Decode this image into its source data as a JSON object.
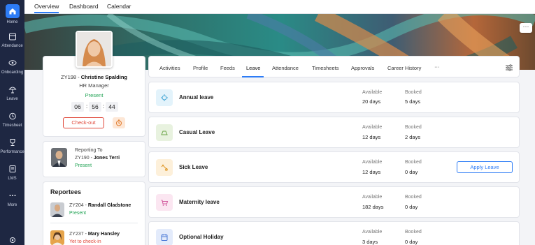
{
  "sidebar": {
    "items": [
      {
        "label": "Home",
        "icon": "home-icon"
      },
      {
        "label": "Attendance",
        "icon": "attendance-icon"
      },
      {
        "label": "Onboarding",
        "icon": "onboarding-icon"
      },
      {
        "label": "Leave",
        "icon": "leave-icon"
      },
      {
        "label": "Timesheet",
        "icon": "timesheet-icon"
      },
      {
        "label": "Performance",
        "icon": "performance-icon"
      },
      {
        "label": "LMS",
        "icon": "lms-icon"
      },
      {
        "label": "More",
        "icon": "more-icon"
      }
    ]
  },
  "topnav": {
    "tabs": [
      {
        "label": "Overview"
      },
      {
        "label": "Dashboard"
      },
      {
        "label": "Calendar"
      }
    ],
    "active": "Overview"
  },
  "banner": {
    "more_label": "···"
  },
  "profile": {
    "id": "ZY198 - ",
    "name": "Christine Spalding",
    "role": "HR Manager",
    "status": "Present",
    "time": {
      "h": "06",
      "m": "56",
      "s": "44"
    },
    "checkout_label": "Check-out"
  },
  "reporting": {
    "label": "Reporting To",
    "id": "ZY190 - ",
    "name": "Jones Terri",
    "status": "Present"
  },
  "reportees": {
    "title": "Reportees",
    "people": [
      {
        "id": "ZY204 - ",
        "name": "Randall Gladstone",
        "status": "Present",
        "status_color": "#22a355"
      },
      {
        "id": "ZY237 - ",
        "name": "Mary Hansley",
        "status": "Yet to check-in",
        "status_color": "#e0483a"
      }
    ]
  },
  "tabs": {
    "items": [
      {
        "label": "Activities"
      },
      {
        "label": "Profile"
      },
      {
        "label": "Feeds"
      },
      {
        "label": "Leave"
      },
      {
        "label": "Attendance"
      },
      {
        "label": "Timesheets"
      },
      {
        "label": "Approvals"
      },
      {
        "label": "Career History"
      },
      {
        "label": "···"
      }
    ],
    "active": "Leave"
  },
  "leave": {
    "available_label": "Available",
    "booked_label": "Booked",
    "apply_label": "Apply Leave",
    "rows": [
      {
        "name": "Annual leave",
        "available": "20 days",
        "booked": "5 days",
        "icon": "annual-leave-icon",
        "color": "#e3f3fb"
      },
      {
        "name": "Casual Leave",
        "available": "12 days",
        "booked": "2 days",
        "icon": "casual-leave-icon",
        "color": "#e8f2df"
      },
      {
        "name": "Sick Leave",
        "available": "12 days",
        "booked": "0 day",
        "icon": "sick-leave-icon",
        "color": "#fdf0da"
      },
      {
        "name": "Maternity leave",
        "available": "182 days",
        "booked": "0 day",
        "icon": "maternity-leave-icon",
        "color": "#fbe6f1"
      },
      {
        "name": "Optional Holiday",
        "available": "3 days",
        "booked": "0 day",
        "icon": "optional-holiday-icon",
        "color": "#e3ebfb"
      }
    ]
  },
  "colors": {
    "accent": "#2d7cf6",
    "sidebar": "#1e2742",
    "present": "#22a355",
    "alert": "#e0483a"
  }
}
